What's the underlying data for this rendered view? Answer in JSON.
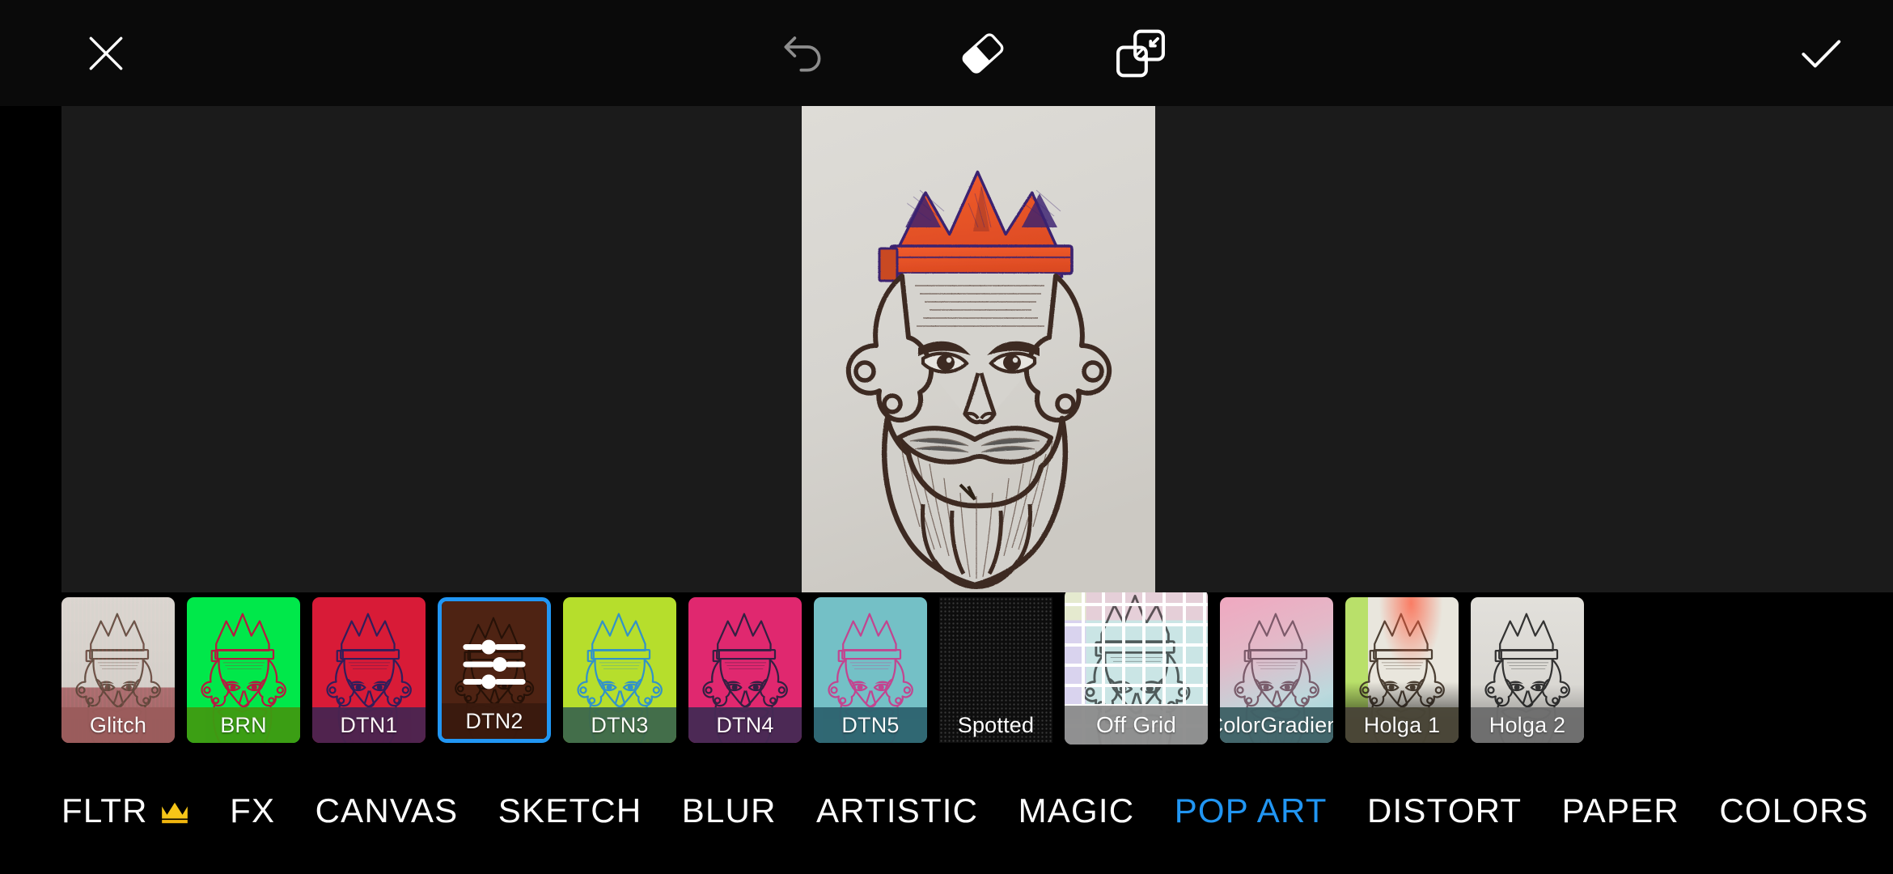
{
  "app": {
    "name": "photo-editor",
    "accent_color": "#2196f3",
    "crown_color": "#f2c41a",
    "toolbar_bg": "#0a0a0a",
    "canvas_bg": "#1b1b1b",
    "strip_bg": "#000000"
  },
  "toolbar": {
    "close_label": "close-icon",
    "undo_label": "undo-icon",
    "eraser_label": "eraser-icon",
    "overlap_label": "overlap-blend-icon",
    "done_label": "checkmark-icon"
  },
  "canvas": {
    "artwork_description": "ink drawing of a bearded king wearing an orange crown",
    "crown_color": "#ec5b2e",
    "ink_color": "#4a2f22",
    "paper_color": "#d8d6d1"
  },
  "filters": {
    "category": "POP ART",
    "selected": "DTN2",
    "items": [
      {
        "label": "Glitch",
        "tint": "#cbc4bd",
        "label_tint": "#9b5c5c",
        "style": "glitch",
        "selected": false,
        "big": false,
        "round": true
      },
      {
        "label": "BRN",
        "tint": "#00e84a",
        "label_tint": "#3e9c12",
        "style": "duotone",
        "ink": "#c01040",
        "selected": false,
        "big": false,
        "round": true
      },
      {
        "label": "DTN1",
        "tint": "#d81b37",
        "label_tint": "#4a2450",
        "style": "duotone",
        "ink": "#2b1e5c",
        "selected": false,
        "big": false,
        "round": true
      },
      {
        "label": "DTN2",
        "tint": "#4e2313",
        "label_tint": "#3a1a0e",
        "style": "duotone",
        "ink": "#241107",
        "selected": true,
        "big": false,
        "round": true
      },
      {
        "label": "DTN3",
        "tint": "#b6de2c",
        "label_tint": "#3f6a4c",
        "style": "duotone",
        "ink": "#2d8fd0",
        "selected": false,
        "big": false,
        "round": true
      },
      {
        "label": "DTN4",
        "tint": "#e0286f",
        "label_tint": "#462a55",
        "style": "duotone",
        "ink": "#2a2040",
        "selected": false,
        "big": false,
        "round": true
      },
      {
        "label": "DTN5",
        "tint": "#74c0c6",
        "label_tint": "#2e6470",
        "style": "duotone",
        "ink": "#c73f8e",
        "selected": false,
        "big": false,
        "round": true
      },
      {
        "label": "Spotted",
        "tint": "#0d0d0d",
        "label_tint": "transparent",
        "style": "spotted",
        "selected": false,
        "big": false,
        "round": false
      },
      {
        "label": "Off Grid",
        "tint": "#ffffff",
        "label_tint": "#8d8d8d",
        "style": "grid",
        "selected": false,
        "big": true,
        "round": true
      },
      {
        "label": "ColorGradient",
        "tint": "#e9a8bc",
        "label_tint": "#3f6166",
        "style": "gradient",
        "ink": "#6b4a5a",
        "selected": false,
        "big": false,
        "round": true
      },
      {
        "label": "Holga 1",
        "tint": "#c9cf9e",
        "label_tint": "#4a4638",
        "style": "holga1",
        "ink": "#3c2f22",
        "selected": false,
        "big": false,
        "round": true
      },
      {
        "label": "Holga 2",
        "tint": "#dcdcdc",
        "label_tint": "#6e6e6e",
        "style": "holga2",
        "ink": "#2a2a2a",
        "selected": false,
        "big": false,
        "round": true
      }
    ]
  },
  "bottom_nav": {
    "active": "POP ART",
    "items": [
      {
        "label": "FLTR",
        "badge": "crown-icon",
        "active": false
      },
      {
        "label": "FX",
        "badge": "",
        "active": false
      },
      {
        "label": "CANVAS",
        "badge": "",
        "active": false
      },
      {
        "label": "SKETCH",
        "badge": "",
        "active": false
      },
      {
        "label": "BLUR",
        "badge": "",
        "active": false
      },
      {
        "label": "ARTISTIC",
        "badge": "",
        "active": false
      },
      {
        "label": "MAGIC",
        "badge": "",
        "active": false
      },
      {
        "label": "POP ART",
        "badge": "",
        "active": true
      },
      {
        "label": "DISTORT",
        "badge": "",
        "active": false
      },
      {
        "label": "PAPER",
        "badge": "",
        "active": false
      },
      {
        "label": "COLORS",
        "badge": "",
        "active": false
      }
    ]
  }
}
